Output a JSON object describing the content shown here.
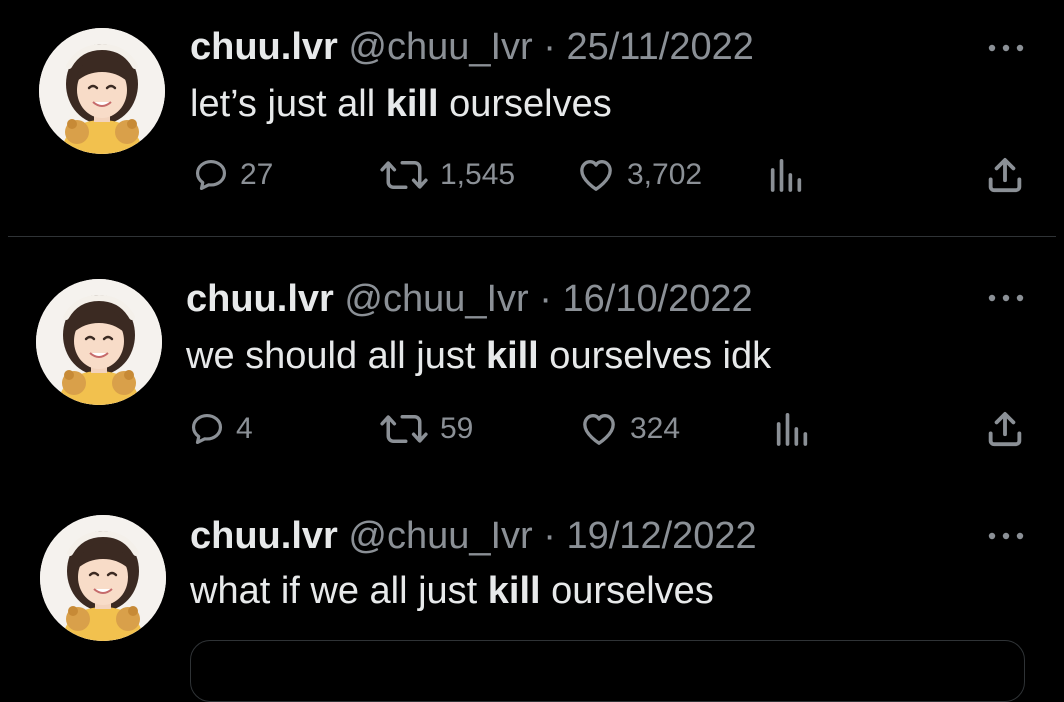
{
  "tweets": [
    {
      "display_name": "chuu.lvr",
      "handle": "@chuu_Ivr",
      "separator": "·",
      "date": "25/11/2022",
      "text_before": "let’s just all ",
      "text_bold": "kill",
      "text_after": " ourselves",
      "replies": "27",
      "retweets": "1,545",
      "likes": "3,702"
    },
    {
      "display_name": "chuu.lvr",
      "handle": "@chuu_Ivr",
      "separator": "·",
      "date": "16/10/2022",
      "text_before": "we should all just ",
      "text_bold": "kill",
      "text_after": " ourselves idk",
      "replies": "4",
      "retweets": "59",
      "likes": "324"
    },
    {
      "display_name": "chuu.lvr",
      "handle": "@chuu_Ivr",
      "separator": "·",
      "date": "19/12/2022",
      "text_before": "what if we all just ",
      "text_bold": "kill",
      "text_after": " ourselves"
    }
  ],
  "icons": {
    "reply": "reply-icon",
    "retweet": "retweet-icon",
    "like": "heart-icon",
    "views": "views-icon",
    "share": "share-icon",
    "more": "more-icon"
  },
  "colors": {
    "background": "#000000",
    "text": "#e7e9ea",
    "muted": "#8b9096",
    "divider": "#2f3336"
  }
}
